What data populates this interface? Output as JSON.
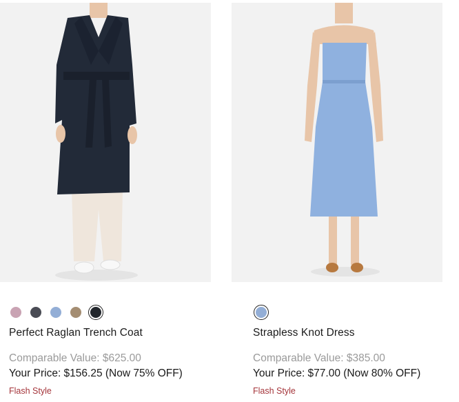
{
  "products": [
    {
      "name": "Perfect Raglan Trench Coat",
      "comparable_value": "Comparable Value: $625.00",
      "your_price": "Your Price: $156.25 (Now 75% OFF)",
      "badge": "Flash Style",
      "swatches": [
        "#c9a3b3",
        "#4a4c55",
        "#93aed6",
        "#a48d72",
        "#22262c"
      ],
      "selected_swatch": "#22262c"
    },
    {
      "name": "Strapless Knot Dress",
      "comparable_value": "Comparable Value: $385.00",
      "your_price": "Your Price: $77.00 (Now 80% OFF)",
      "badge": "Flash Style",
      "swatches": [
        "#93aed6"
      ],
      "selected_swatch": "#93aed6"
    }
  ],
  "colors": {
    "image_bg": "#f2f2f2",
    "sale_red": "#a4343a",
    "muted_text": "#9a9a9a"
  }
}
